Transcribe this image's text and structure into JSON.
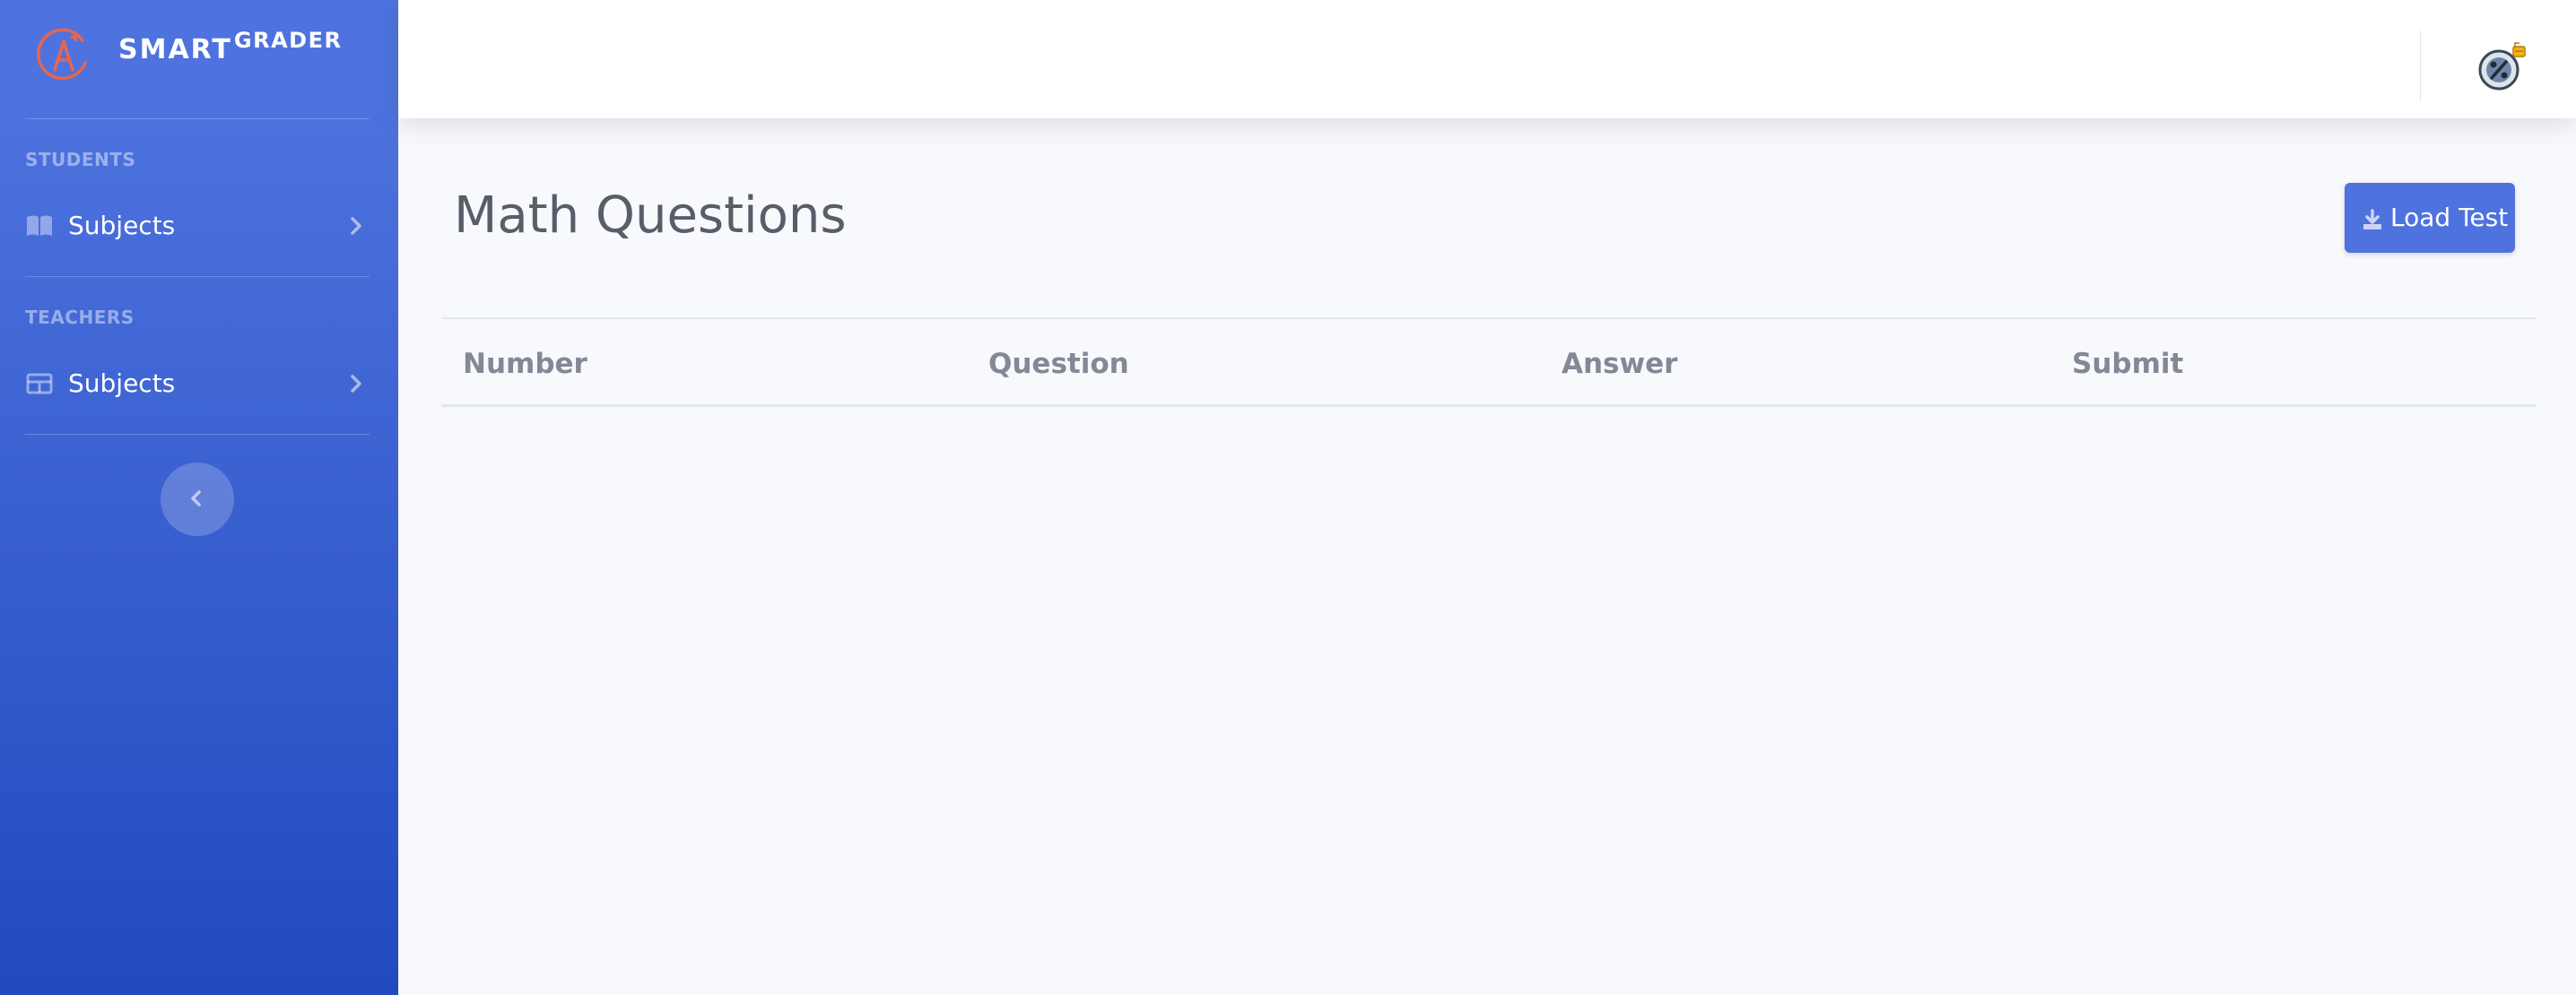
{
  "brand": {
    "name": "SMART",
    "superscript": "GRADER",
    "logo_icon": "a-plus-grade-icon"
  },
  "sidebar": {
    "sections": [
      {
        "heading": "STUDENTS",
        "item": {
          "label": "Subjects",
          "icon": "book-open-icon"
        }
      },
      {
        "heading": "TEACHERS",
        "item": {
          "label": "Subjects",
          "icon": "table-icon"
        }
      }
    ],
    "toggle_icon": "chevron-left-icon"
  },
  "topbar": {
    "avatar_icon": "math-percent-avatar-icon"
  },
  "main": {
    "title": "Math Questions",
    "load_button": {
      "label": "Load Test",
      "icon": "download-icon"
    },
    "table": {
      "columns": [
        "Number",
        "Question",
        "Answer",
        "Submit"
      ],
      "rows": []
    }
  },
  "colors": {
    "primary": "#4e73df",
    "sidebar_end": "#224abe",
    "text": "#5a5c69",
    "muted": "#858796",
    "logo": "#e8664a"
  }
}
